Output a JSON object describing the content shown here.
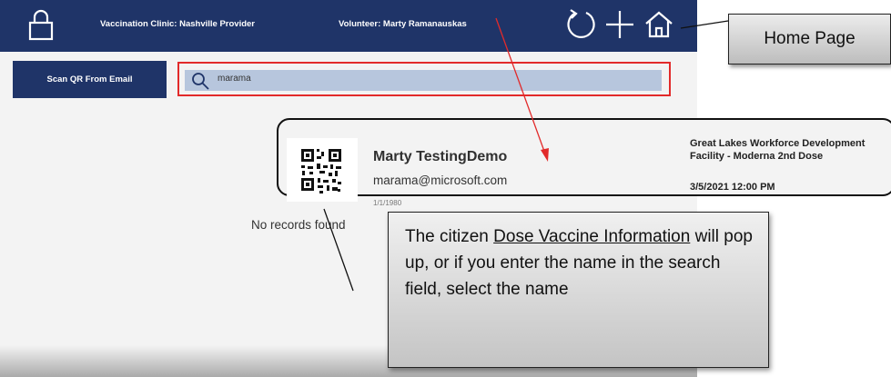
{
  "header": {
    "clinic_title": "Vaccination Clinic: Nashville Provider",
    "volunteer_title": "Volunteer: Marty  Ramanauskas",
    "icons": [
      "lock-icon",
      "refresh-icon",
      "add-icon",
      "home-icon"
    ]
  },
  "toolbar": {
    "scan_label": "Scan QR From Email"
  },
  "search": {
    "value": "marama"
  },
  "record": {
    "name": "Marty TestingDemo",
    "email": "marama@microsoft.com",
    "dob": "1/1/1980",
    "facility_line1": "Great Lakes Workforce Development",
    "facility_line2": "Facility - Moderna 2nd Dose",
    "appointment": "3/5/2021 12:00 PM"
  },
  "status_text": "No records found",
  "callouts": {
    "home_page": "Home Page",
    "info_part1": "The citizen ",
    "info_underlined": "Dose Vaccine Information",
    "info_part2": " will pop up, or if you enter the name in the search field, select the name"
  },
  "colors": {
    "header_bg": "#1f3468",
    "highlight_border": "#e22a2a",
    "search_field_bg": "#b7c6dd"
  }
}
